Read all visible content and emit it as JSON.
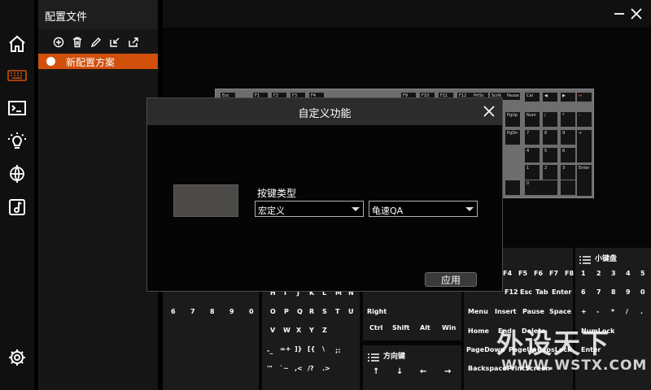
{
  "profile_panel": {
    "title": "配置文件",
    "item_label": "新配置方案",
    "tool_icons": [
      "add-icon",
      "trash-icon",
      "pencil-icon",
      "import-icon",
      "export-icon"
    ]
  },
  "rail_icons": [
    "home-icon",
    "keyboard-icon",
    "terminal-icon",
    "lightbulb-icon",
    "globe-icon",
    "music-icon",
    "settings-icon"
  ],
  "colors": {
    "accent": "#d0500c",
    "panel": "#161616",
    "background": "#000000"
  },
  "keyboard": {
    "row1": [
      "Esc",
      "F1",
      "F2",
      "F3",
      "F4",
      "F5",
      "F6",
      "F7",
      "F8",
      "F9",
      "F10",
      "F11",
      "F12",
      "PrtSc",
      "Scrlk",
      "Pause"
    ],
    "numpad_top": [
      "Cal",
      "◀",
      "▶",
      "◀/▶",
      "⏯"
    ],
    "nav": [
      "PgUp",
      "PgDn"
    ],
    "numpad": [
      "Num",
      "/",
      "*",
      "-",
      "7",
      "8",
      "9",
      "+",
      "4",
      "5",
      "6",
      "1",
      "2",
      "3",
      "Enter",
      "0",
      "."
    ]
  },
  "panels": {
    "letters_row_a": [
      "H",
      "I",
      "J",
      "K",
      "L",
      "M",
      "N"
    ],
    "numbers": [
      "6",
      "7",
      "8",
      "9",
      "0"
    ],
    "letters_row_b": [
      "O",
      "P",
      "Q",
      "R",
      "S",
      "T",
      "U"
    ],
    "letters_row_c": [
      "V",
      "W",
      "X",
      "Y",
      "Z"
    ],
    "symbols_row_a": [
      "-_",
      "=+",
      "]}",
      "[{",
      "\\",
      ";:"
    ],
    "symbols_row_b": [
      "'\"",
      "`~",
      ",<",
      "/?",
      ".>"
    ],
    "modifiers_top": "Right",
    "modifiers": [
      "Ctrl",
      "Shift",
      "Alt",
      "Win"
    ],
    "arrows_title": "方向键",
    "arrows": [
      "↑",
      "↓",
      "←",
      "→"
    ],
    "function_row_a": [
      "F4",
      "F5",
      "F6",
      "F7",
      "F8"
    ],
    "function_row_b": [
      "F9",
      "F10",
      "F11",
      "F12",
      "Esc",
      "Tab",
      "Enter"
    ],
    "function_row_c": [
      "Menu",
      "Insert",
      "Pause",
      "Space"
    ],
    "function_row_d": [
      "Home",
      "End",
      "Delete"
    ],
    "function_row_e": [
      "PageDown",
      "PageUp",
      "CapsLock"
    ],
    "function_row_f": [
      "Backspace",
      "PrintScreen"
    ],
    "numpad_title": "小键盘",
    "numpad_row_a": [
      "1",
      "2",
      "3",
      "4",
      "5"
    ],
    "numpad_row_b": [
      "6",
      "7",
      "8",
      "9",
      "0"
    ],
    "numpad_row_c": [
      "+",
      "-",
      "*",
      "/",
      "."
    ],
    "numpad_row_d": "NumLock",
    "numpad_row_e": "Enter"
  },
  "dialog": {
    "title": "自定义功能",
    "key_type_label": "按键类型",
    "type_value": "宏定义",
    "second_value": "龟速QA",
    "apply_label": "应用"
  },
  "watermark": {
    "title": "外设天下",
    "url": "WWW.WSTX.COM"
  }
}
